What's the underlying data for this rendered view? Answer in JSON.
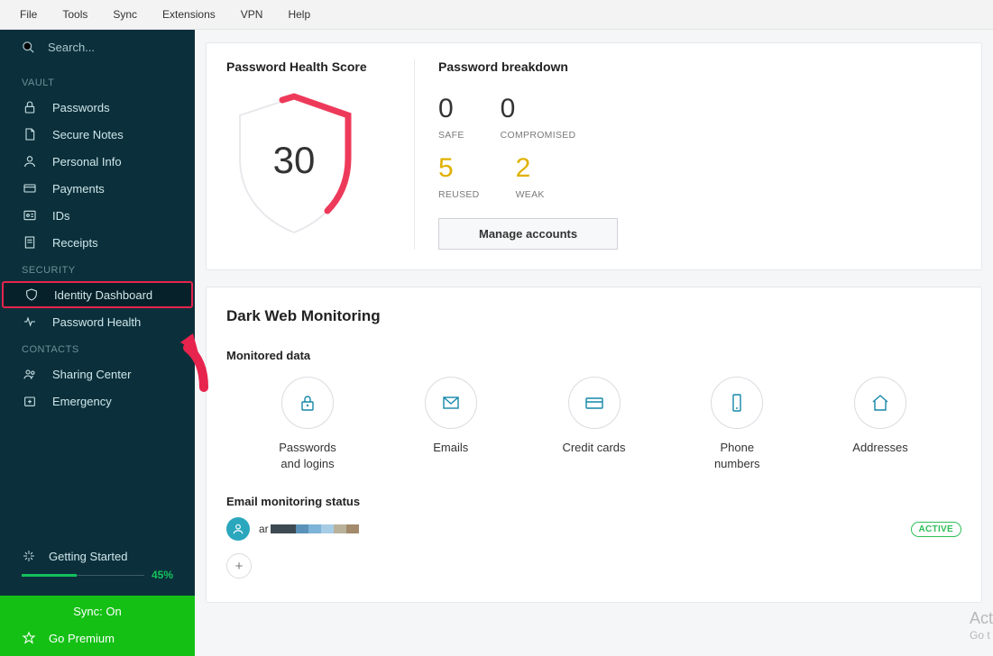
{
  "menubar": [
    "File",
    "Tools",
    "Sync",
    "Extensions",
    "VPN",
    "Help"
  ],
  "search": {
    "placeholder": "Search..."
  },
  "sections": {
    "vault": {
      "label": "VAULT",
      "items": [
        "Passwords",
        "Secure Notes",
        "Personal Info",
        "Payments",
        "IDs",
        "Receipts"
      ]
    },
    "security": {
      "label": "SECURITY",
      "items": [
        "Identity Dashboard",
        "Password Health"
      ]
    },
    "contacts": {
      "label": "CONTACTS",
      "items": [
        "Sharing Center",
        "Emergency"
      ]
    }
  },
  "getting_started": {
    "label": "Getting Started",
    "percent_label": "45%",
    "percent": 45
  },
  "sync": {
    "label": "Sync: On"
  },
  "premium": {
    "label": "Go Premium"
  },
  "health": {
    "title": "Password Health Score",
    "score": "30",
    "breakdown_title": "Password breakdown",
    "cells": {
      "safe": {
        "num": "0",
        "label": "SAFE"
      },
      "compromised": {
        "num": "0",
        "label": "COMPROMISED"
      },
      "reused": {
        "num": "5",
        "label": "REUSED"
      },
      "weak": {
        "num": "2",
        "label": "WEAK"
      }
    },
    "manage": "Manage accounts"
  },
  "dwm": {
    "title": "Dark Web Monitoring",
    "monitored_label": "Monitored data",
    "items": [
      "Passwords\nand logins",
      "Emails",
      "Credit cards",
      "Phone\nnumbers",
      "Addresses"
    ],
    "ems_title": "Email monitoring status",
    "email_prefix": "ar",
    "active": "ACTIVE"
  },
  "watermark": {
    "l1": "Act",
    "l2": "Go t"
  },
  "colors": {
    "stripes": [
      "#3e4a52",
      "#3e4a52",
      "#5a92b9",
      "#7db3d6",
      "#a7cde6",
      "#b9b19a",
      "#a38a6b"
    ]
  }
}
